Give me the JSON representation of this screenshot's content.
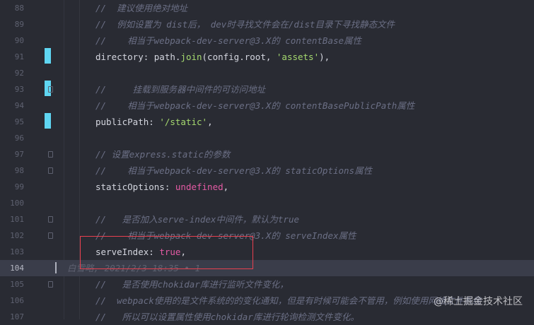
{
  "editor": {
    "lines": [
      {
        "num": "88",
        "tokens": [
          {
            "t": "//  建议使用绝对地址",
            "c": "comment"
          }
        ]
      },
      {
        "num": "89",
        "tokens": [
          {
            "t": "//  例如设置为 dist后， dev时寻找文件会在/dist目录下寻找静态文件",
            "c": "comment"
          }
        ]
      },
      {
        "num": "90",
        "tokens": [
          {
            "t": "//    相当于webpack-dev-server@3.X的 contentBase属性",
            "c": "comment"
          }
        ]
      },
      {
        "num": "91",
        "tokens": [
          {
            "t": "directory",
            "c": "ident"
          },
          {
            "t": ": path.",
            "c": "punct"
          },
          {
            "t": "join",
            "c": "func"
          },
          {
            "t": "(config.root, ",
            "c": "punct"
          },
          {
            "t": "'assets'",
            "c": "string"
          },
          {
            "t": "),",
            "c": "punct"
          }
        ]
      },
      {
        "num": "92",
        "tokens": []
      },
      {
        "num": "93",
        "tokens": [
          {
            "t": "//     挂载到服务器中间件的可访问地址",
            "c": "comment"
          }
        ]
      },
      {
        "num": "94",
        "tokens": [
          {
            "t": "//    相当于webpack-dev-server@3.X的 contentBasePublicPath属性",
            "c": "comment"
          }
        ]
      },
      {
        "num": "95",
        "tokens": [
          {
            "t": "publicPath",
            "c": "ident"
          },
          {
            "t": ": ",
            "c": "punct"
          },
          {
            "t": "'/static'",
            "c": "string"
          },
          {
            "t": ",",
            "c": "punct"
          }
        ]
      },
      {
        "num": "96",
        "tokens": []
      },
      {
        "num": "97",
        "tokens": [
          {
            "t": "// 设置express.static的参数",
            "c": "comment"
          }
        ]
      },
      {
        "num": "98",
        "tokens": [
          {
            "t": "//    相当于webpack-dev-server@3.X的 staticOptions属性",
            "c": "comment"
          }
        ]
      },
      {
        "num": "99",
        "tokens": [
          {
            "t": "staticOptions",
            "c": "ident"
          },
          {
            "t": ": ",
            "c": "punct"
          },
          {
            "t": "undefined",
            "c": "keyword"
          },
          {
            "t": ",",
            "c": "punct"
          }
        ]
      },
      {
        "num": "100",
        "tokens": []
      },
      {
        "num": "101",
        "tokens": [
          {
            "t": "//   是否加入serve-index中间件，默认为true",
            "c": "comment"
          }
        ]
      },
      {
        "num": "102",
        "tokens": [
          {
            "t": "//    相当于webpack-dev-server@3.X的 serveIndex属性",
            "c": "comment"
          }
        ]
      },
      {
        "num": "103",
        "tokens": [
          {
            "t": "serveIndex",
            "c": "ident"
          },
          {
            "t": ": ",
            "c": "punct"
          },
          {
            "t": "true",
            "c": "keyword"
          },
          {
            "t": ",",
            "c": "punct"
          }
        ]
      },
      {
        "num": "104",
        "tokens": [
          {
            "t": "白雪略, 2021/2/3 18:35 • 1",
            "c": "blame-text"
          }
        ],
        "current": true
      },
      {
        "num": "105",
        "tokens": [
          {
            "t": "//   是否使用chokidar库进行监听文件变化，",
            "c": "comment"
          }
        ]
      },
      {
        "num": "106",
        "tokens": [
          {
            "t": "//  webpack使用的是文件系统的的变化通知，但是有时候可能会不管用，例如使用网络文件系统",
            "c": "comment"
          }
        ]
      },
      {
        "num": "107",
        "tokens": [
          {
            "t": "//   所以可以设置属性使用chokidar库进行轮询检测文件变化。",
            "c": "comment"
          }
        ]
      }
    ]
  },
  "watermark": "@稀土掘金技术社区",
  "colors": {
    "background": "#292b33",
    "current_line": "#3a3d4a",
    "change_bar": "#5fd6f2",
    "highlight_box": "#e8404f"
  }
}
